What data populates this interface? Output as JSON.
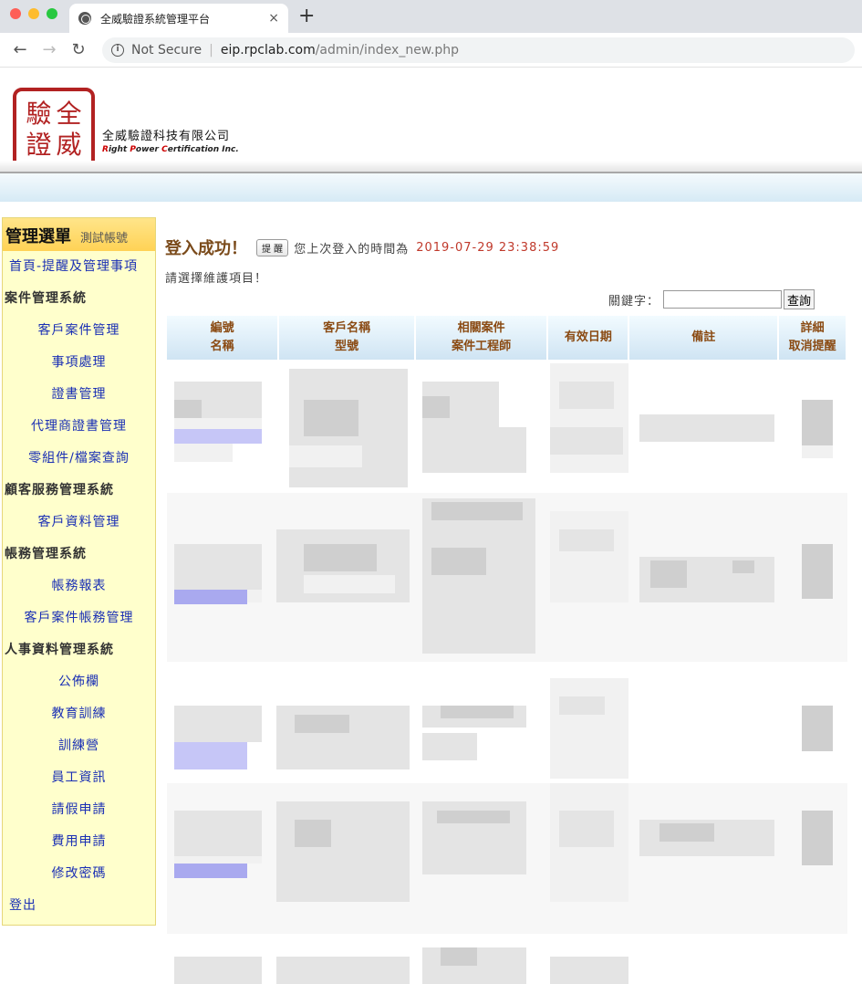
{
  "browser": {
    "tab_title": "全威驗證系統管理平台",
    "tab_close": "×",
    "new_tab": "+",
    "back": "←",
    "forward": "→",
    "reload": "↻",
    "security": "Not Secure",
    "url_domain": "eip.rpclab.com",
    "url_path": "/admin/index_new.php"
  },
  "header": {
    "seal_chars": [
      "驗",
      "全",
      "證",
      "威"
    ],
    "company_zh": "全威驗證科技有限公司",
    "company_en": [
      "R",
      "ight ",
      "P",
      "ower ",
      "C",
      "ertification Inc."
    ]
  },
  "sidebar": {
    "title": "管理選單",
    "account": "測試帳號",
    "items": [
      {
        "type": "left",
        "label": "首頁-提醒及管理事項"
      },
      {
        "type": "cat",
        "label": "案件管理系統"
      },
      {
        "type": "center",
        "label": "客戶案件管理"
      },
      {
        "type": "center",
        "label": "事項處理"
      },
      {
        "type": "center",
        "label": "證書管理"
      },
      {
        "type": "center",
        "label": "代理商證書管理"
      },
      {
        "type": "center",
        "label": "零組件/檔案查詢"
      },
      {
        "type": "cat",
        "label": "顧客服務管理系統"
      },
      {
        "type": "center",
        "label": "客戶資料管理"
      },
      {
        "type": "cat",
        "label": "帳務管理系統"
      },
      {
        "type": "center",
        "label": "帳務報表"
      },
      {
        "type": "center",
        "label": "客戶案件帳務管理"
      },
      {
        "type": "cat",
        "label": "人事資料管理系統"
      },
      {
        "type": "center",
        "label": "公佈欄"
      },
      {
        "type": "center",
        "label": "教育訓練"
      },
      {
        "type": "center",
        "label": "訓練營"
      },
      {
        "type": "center",
        "label": "員工資訊"
      },
      {
        "type": "center",
        "label": "請假申請"
      },
      {
        "type": "center",
        "label": "費用申請"
      },
      {
        "type": "center",
        "label": "修改密碼"
      },
      {
        "type": "left",
        "label": "登出"
      }
    ]
  },
  "main": {
    "login_ok": "登入成功！",
    "remind_btn": "提 醒",
    "last_login_msg": "您上次登入的時間為",
    "last_login_time": "2019-07-29 23:38:59",
    "choose": "請選擇維護項目！",
    "keyword_label": "關鍵字：",
    "keyword_value": "",
    "search_btn": "查詢",
    "columns": [
      [
        "編號",
        "名稱"
      ],
      [
        "客戶名稱",
        "型號"
      ],
      [
        "相關案件",
        "案件工程師"
      ],
      [
        "有效日期"
      ],
      [
        "備註"
      ],
      [
        "詳細",
        "取消提醒"
      ]
    ]
  }
}
